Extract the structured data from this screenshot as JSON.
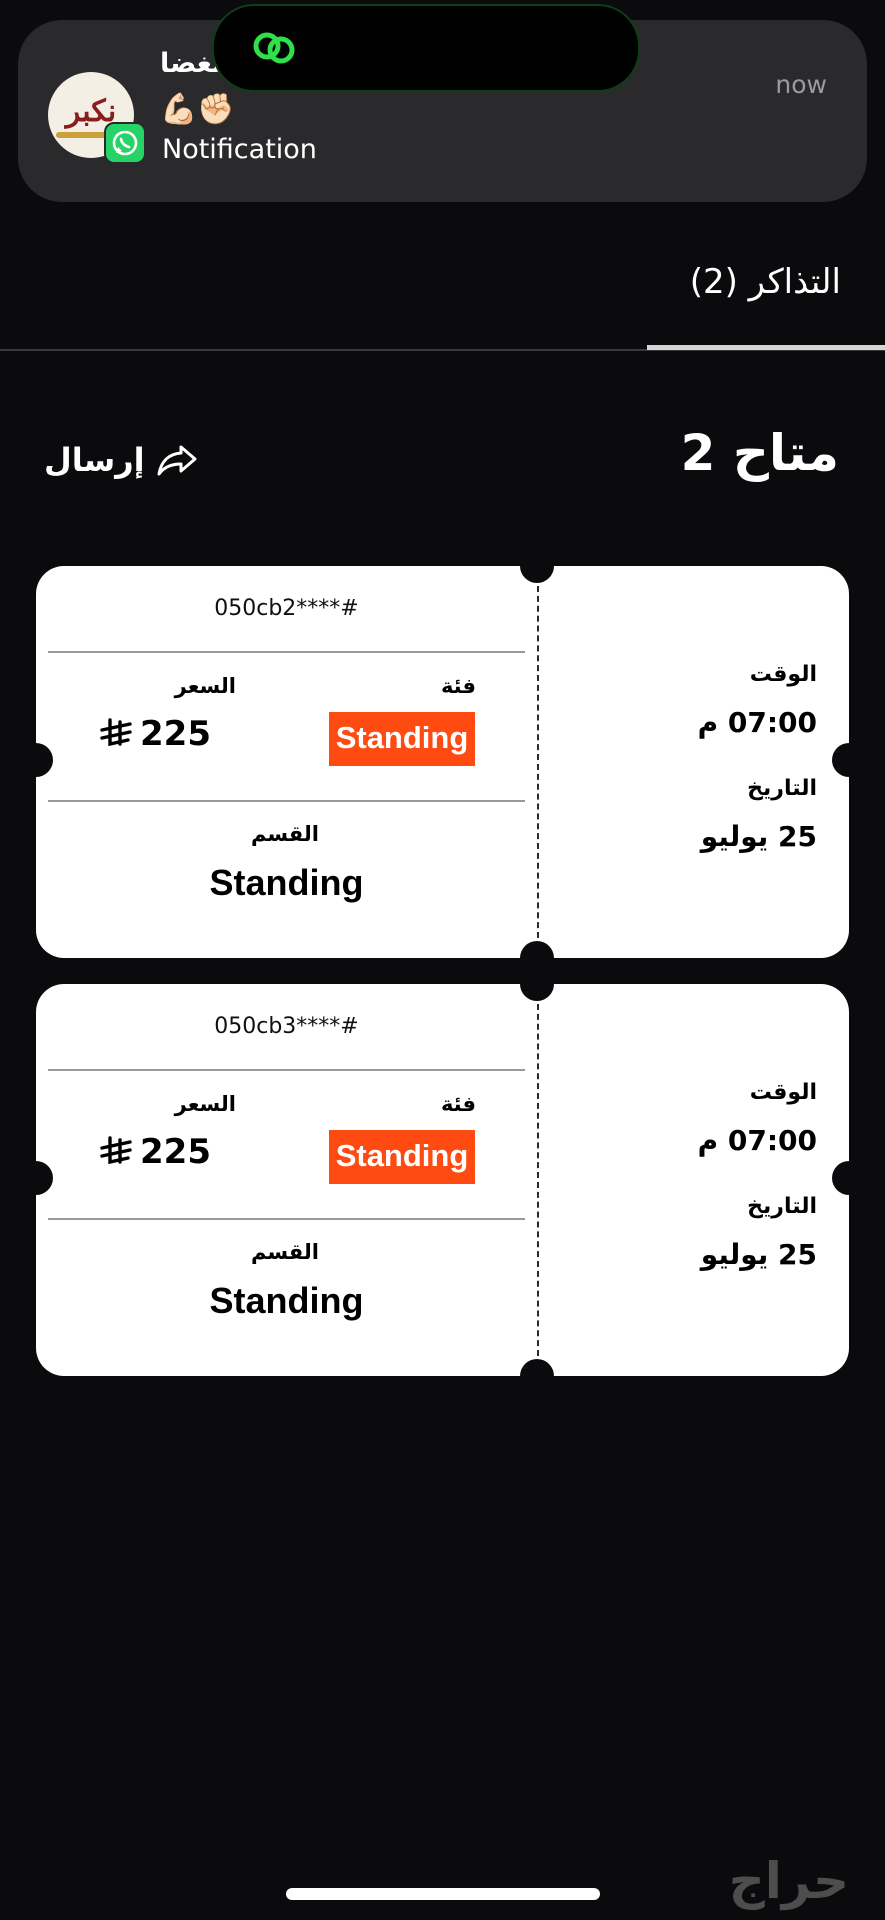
{
  "notification": {
    "title": "الغضا",
    "emoji": "💪🏻✊🏻",
    "body": "Notification",
    "time": "now",
    "avatar_logo": "نكبر",
    "app_badge_icon": "whatsapp-icon"
  },
  "tabs": {
    "active_label": "التذاكر (2)"
  },
  "header": {
    "available": "متاح 2",
    "send_label": "إرسال",
    "send_icon": "share-forward-icon"
  },
  "tickets": [
    {
      "code": "050cb2****#",
      "category_label": "فئة",
      "category_value": "Standing",
      "price_label": "السعر",
      "price_value": "225",
      "currency_icon": "riyal-symbol-icon",
      "section_label": "القسم",
      "section_value": "Standing",
      "time_label": "الوقت",
      "time_value": "07:00 م",
      "date_label": "التاريخ",
      "date_value": "25 يوليو"
    },
    {
      "code": "050cb3****#",
      "category_label": "فئة",
      "category_value": "Standing",
      "price_label": "السعر",
      "price_value": "225",
      "currency_icon": "riyal-symbol-icon",
      "section_label": "القسم",
      "section_value": "Standing",
      "time_label": "الوقت",
      "time_value": "07:00 م",
      "date_label": "التاريخ",
      "date_value": "25 يوليو"
    }
  ],
  "footer": {
    "watermark": "حراج"
  },
  "colors": {
    "background": "#0b0b0d",
    "badge": "#ff4a12",
    "notification_bg": "#2a2a2d",
    "whatsapp": "#25d366"
  }
}
